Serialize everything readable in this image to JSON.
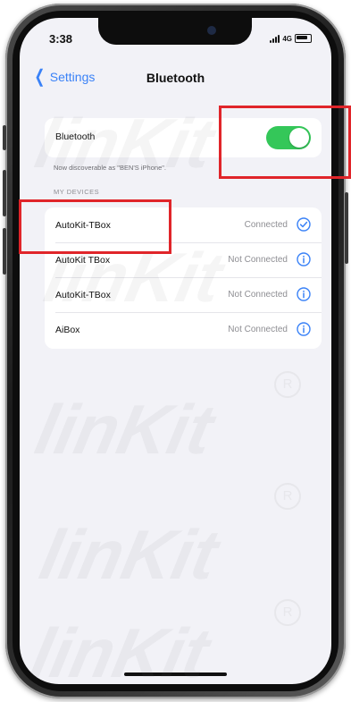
{
  "status_bar": {
    "time": "3:38",
    "network": "4G",
    "signal_icon": "cellular-signal-icon",
    "battery_icon": "battery-icon"
  },
  "nav": {
    "back_label": "Settings",
    "back_icon": "chevron-left-icon",
    "title": "Bluetooth"
  },
  "bluetooth": {
    "label": "Bluetooth",
    "enabled": true,
    "discoverable_text": "Now discoverable as \"BEN'S iPhone\"."
  },
  "devices_section": {
    "header": "MY DEVICES",
    "devices": [
      {
        "name": "AutoKit-TBox",
        "status": "Connected",
        "icon": "connected-check-icon"
      },
      {
        "name": "AutoKit TBox",
        "status": "Not Connected",
        "icon": "info-icon"
      },
      {
        "name": "AutoKit-TBox",
        "status": "Not Connected",
        "icon": "info-icon"
      },
      {
        "name": "AiBox",
        "status": "Not Connected",
        "icon": "info-icon"
      }
    ]
  },
  "colors": {
    "accent": "#3a82f7",
    "toggle_on": "#34c759",
    "highlight": "#e0252a",
    "screen_bg": "#f2f2f7"
  }
}
